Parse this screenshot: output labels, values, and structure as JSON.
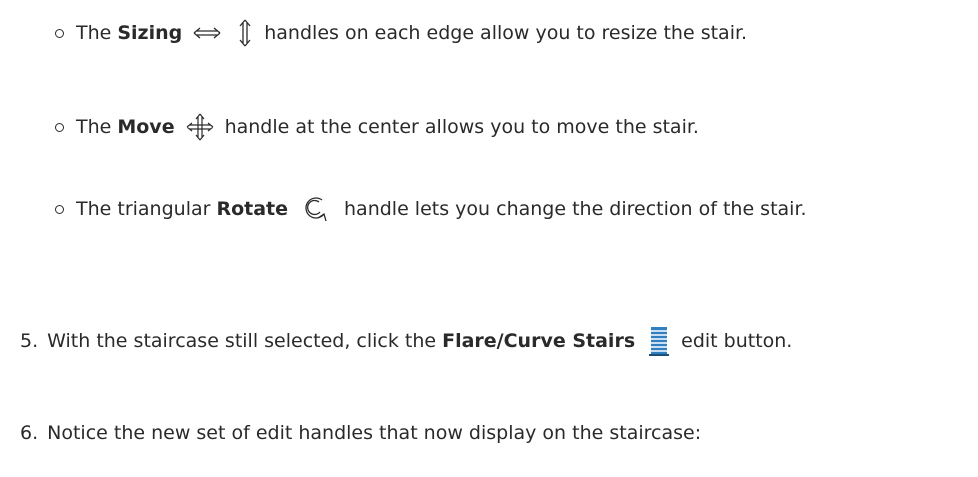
{
  "sub_items": [
    {
      "prefix": "The ",
      "bold": "Sizing",
      "icon_names": [
        "double-arrow-horizontal-icon",
        "double-arrow-vertical-icon"
      ],
      "suffix": " handles on each edge allow you to resize the stair."
    },
    {
      "prefix": "The ",
      "bold": "Move",
      "icon_names": [
        "move-arrows-icon"
      ],
      "suffix": " handle at the center allows you to move the stair."
    },
    {
      "prefix": "The triangular ",
      "bold": "Rotate",
      "icon_names": [
        "rotate-arrow-icon"
      ],
      "suffix": " handle lets you change the direction of the stair."
    }
  ],
  "steps": [
    {
      "number": "5.",
      "prefix": "With the staircase still selected, click the ",
      "bold": "Flare/Curve Stairs",
      "icon_names": [
        "flare-curve-stairs-icon"
      ],
      "suffix": " edit button."
    },
    {
      "number": "6.",
      "text": "Notice the new set of edit handles that now display on the staircase:"
    }
  ],
  "colors": {
    "text": "#2a2a2a",
    "stairs_icon": "#2f7fc1"
  }
}
